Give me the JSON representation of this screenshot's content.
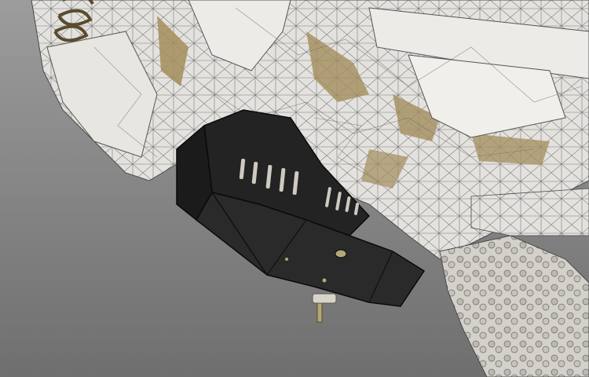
{
  "scene": {
    "subject": "skid-plate-icon",
    "palette": {
      "background_top": "#9c9c9c",
      "background_bottom": "#6f6f6f",
      "mesh_fill": "#e4e2de",
      "mesh_line": "#5a5a5a",
      "internal_tan": "#a38d5c",
      "plate_dark": "#1b1b1b",
      "plate_mid": "#2a2a2a",
      "plate_edge": "#0a0a0a",
      "bolt": "#b3a77a"
    }
  }
}
